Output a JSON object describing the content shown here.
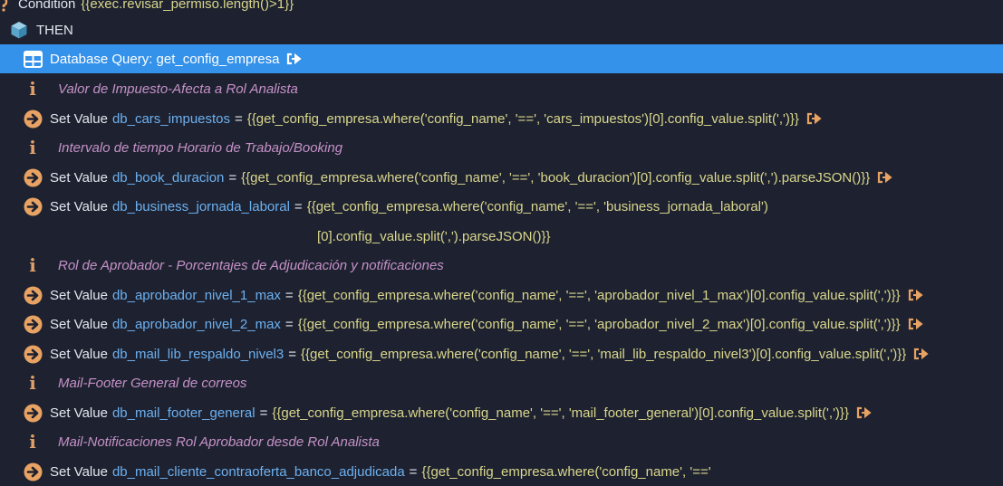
{
  "condition": {
    "label": "Condition",
    "expr": "{{exec.revisar_permiso.length()>1}}"
  },
  "then": {
    "label": "THEN"
  },
  "query": {
    "label": "Database Query: get_config_empresa"
  },
  "set_label": "Set Value",
  "colors": {
    "selected": "#3592ea",
    "variable": "#6cb0f0",
    "expr": "#d9d68c",
    "comment": "#c591c8",
    "icon": "#e8a263"
  },
  "items": [
    {
      "comment": "Valor de Impuesto-Afecta a Rol Analista"
    },
    {
      "var": "db_cars_impuestos",
      "expr": "{{get_config_empresa.where('config_name', '==', 'cars_impuestos')[0].config_value.split(',')}}"
    },
    {
      "comment": "Intervalo de tiempo Horario de Trabajo/Booking"
    },
    {
      "var": "db_book_duracion",
      "expr": "{{get_config_empresa.where('config_name', '==', 'book_duracion')[0].config_value.split(',').parseJSON()}}"
    },
    {
      "var": "db_business_jornada_laboral",
      "expr": "{{get_config_empresa.where('config_name', '==', 'business_jornada_laboral')",
      "expr2": "[0].config_value.split(',').parseJSON()}}"
    },
    {
      "comment": "Rol de Aprobador - Porcentajes de Adjudicación y notificaciones"
    },
    {
      "var": "db_aprobador_nivel_1_max",
      "expr": "{{get_config_empresa.where('config_name', '==', 'aprobador_nivel_1_max')[0].config_value.split(',')}}"
    },
    {
      "var": "db_aprobador_nivel_2_max",
      "expr": "{{get_config_empresa.where('config_name', '==', 'aprobador_nivel_2_max')[0].config_value.split(',')}}"
    },
    {
      "var": "db_mail_lib_respaldo_nivel3",
      "expr": "{{get_config_empresa.where('config_name', '==', 'mail_lib_respaldo_nivel3')[0].config_value.split(',')}}"
    },
    {
      "comment": "Mail-Footer General de correos"
    },
    {
      "var": "db_mail_footer_general",
      "expr": "{{get_config_empresa.where('config_name', '==', 'mail_footer_general')[0].config_value.split(',')}}"
    },
    {
      "comment": "Mail-Notificaciones Rol Aprobador desde Rol Analista"
    },
    {
      "var": "db_mail_cliente_contraoferta_banco_adjudicada",
      "expr": "{{get_config_empresa.where('config_name', '=='"
    }
  ]
}
